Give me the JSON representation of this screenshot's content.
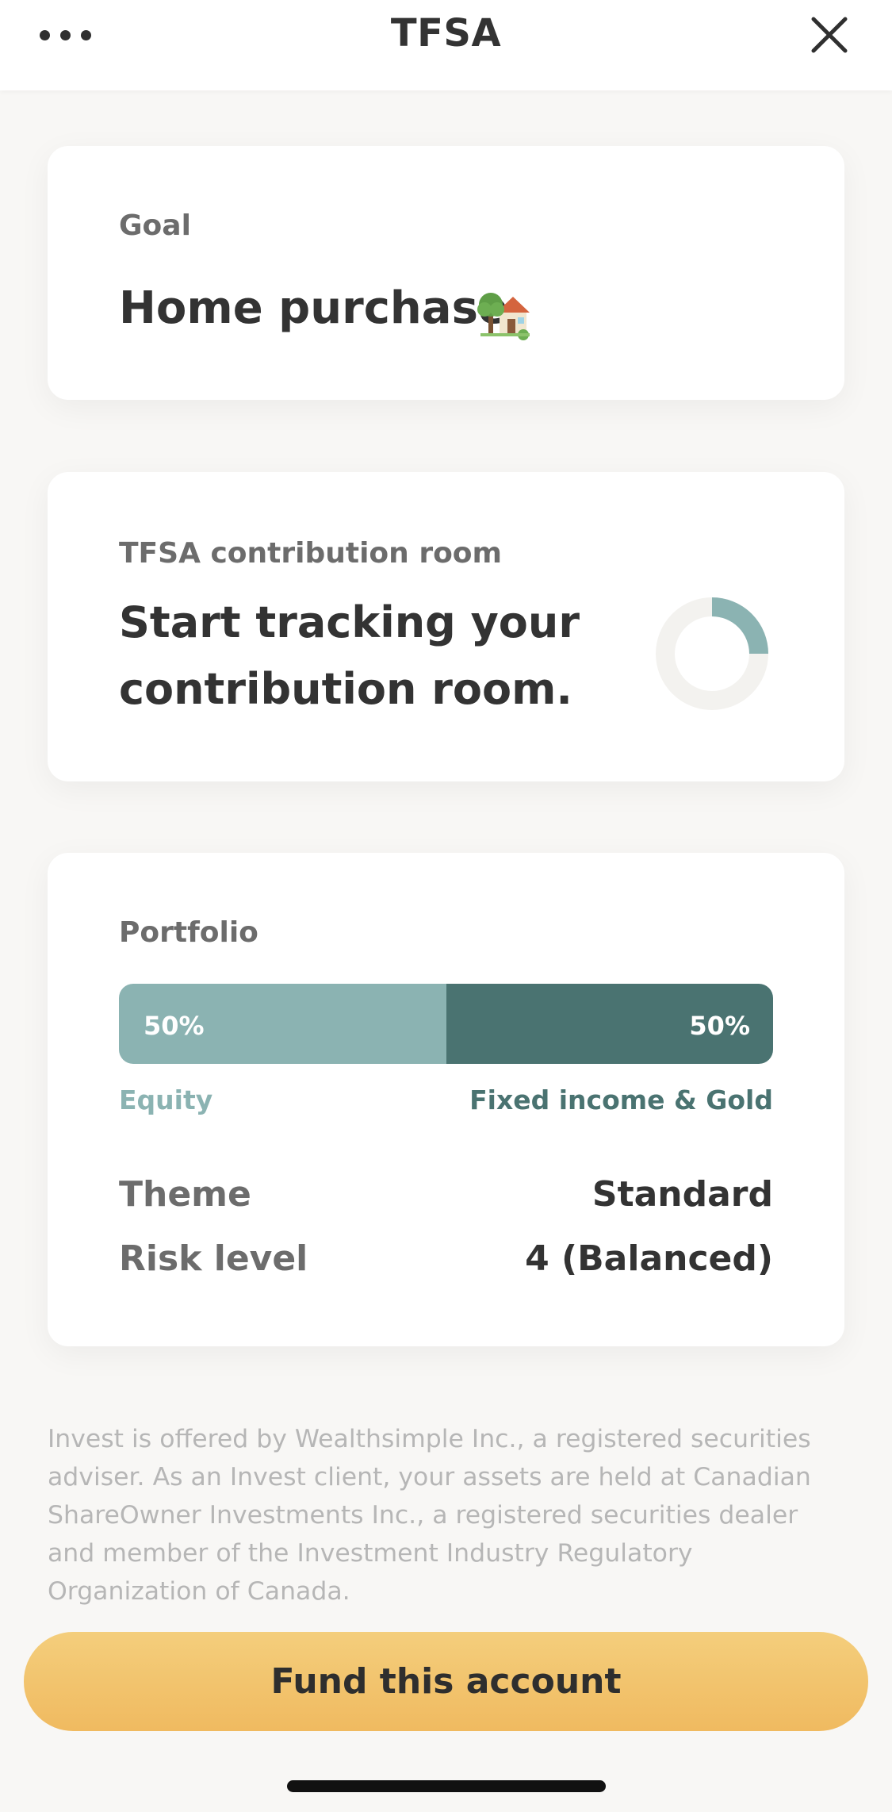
{
  "header": {
    "title": "TFSA",
    "more_icon": "more-horizontal-icon",
    "close_icon": "close-icon"
  },
  "goal_card": {
    "label": "Goal",
    "value": "Home purchase",
    "icon": "house-with-garden-icon"
  },
  "contribution_card": {
    "label": "TFSA contribution room",
    "message": "Start tracking your contribution room.",
    "indicator_icon": "contribution-donut-icon",
    "accent_color": "#8bb3b2"
  },
  "portfolio_card": {
    "label": "Portfolio",
    "allocation": [
      {
        "name": "Equity",
        "percent_label": "50%",
        "fraction": 0.5,
        "color": "#8bb3b2"
      },
      {
        "name": "Fixed income & Gold",
        "percent_label": "50%",
        "fraction": 0.5,
        "color": "#4a7371"
      }
    ],
    "details": [
      {
        "label": "Theme",
        "value": "Standard"
      },
      {
        "label": "Risk level",
        "value": "4 (Balanced)"
      }
    ]
  },
  "disclaimer": "Invest is offered by Wealthsimple Inc., a registered securities adviser. As an Invest client, your assets are held at Canadian ShareOwner Investments Inc., a registered securities dealer and member of the Investment Industry Regulatory Organization of Canada.",
  "fund_button": {
    "label": "Fund this account",
    "color": "#f2c46e"
  }
}
